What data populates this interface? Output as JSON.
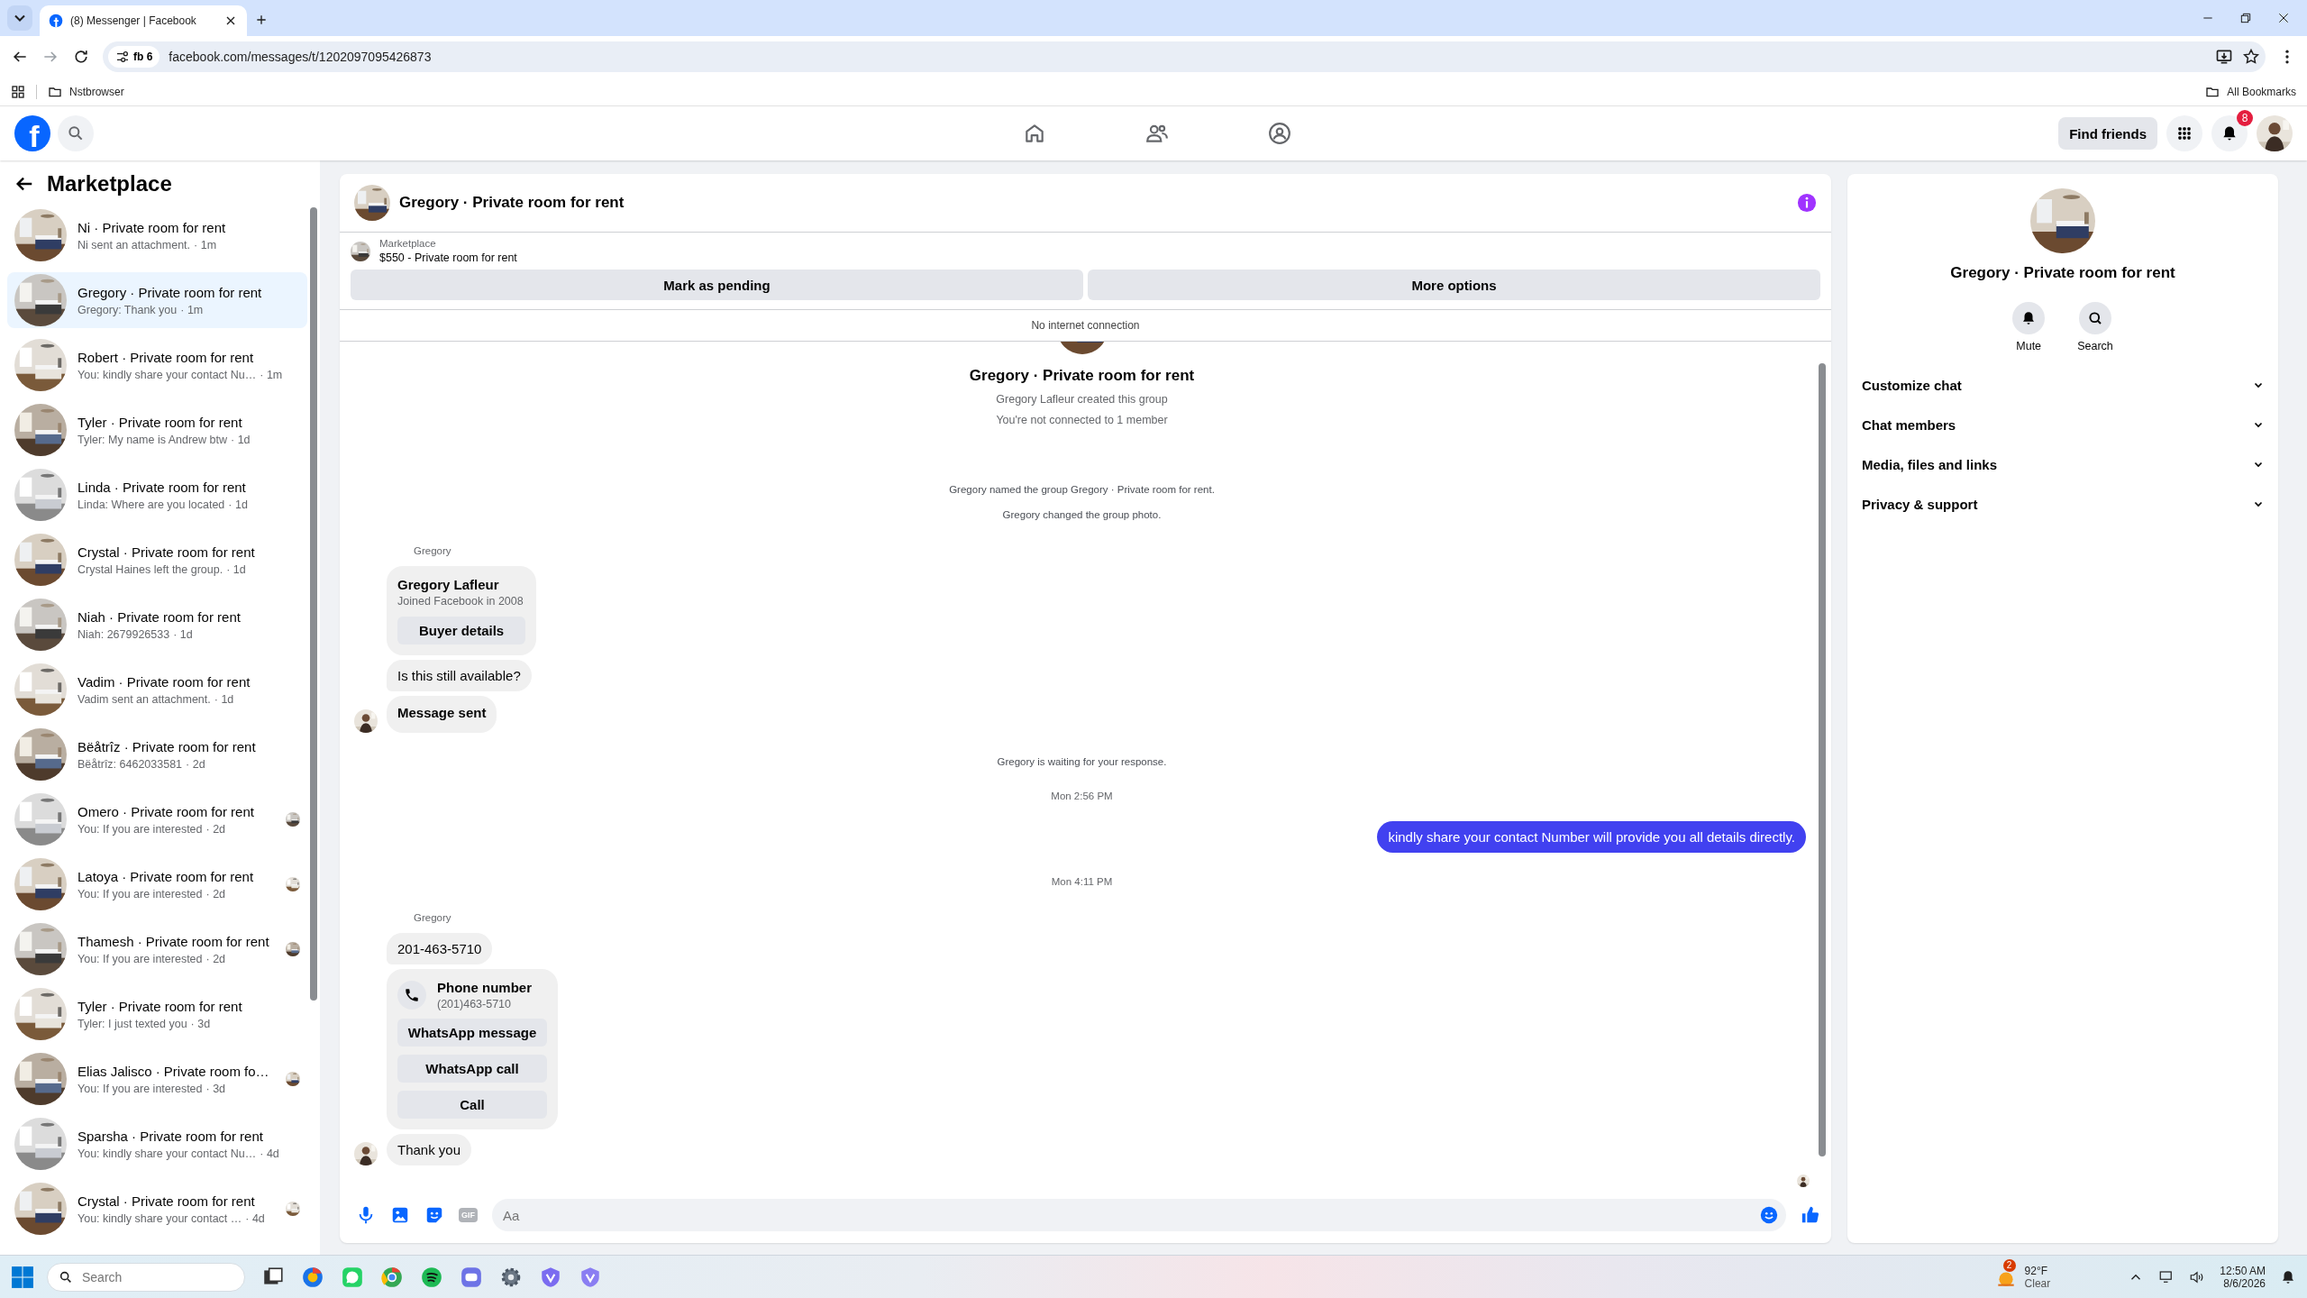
{
  "browser": {
    "tab_title": "(8) Messenger | Facebook",
    "chip": "fb 6",
    "url": "facebook.com/messages/t/1202097095426873",
    "bookmarks": [
      "Nstbrowser"
    ],
    "all_bookmarks": "All Bookmarks"
  },
  "header": {
    "logo": "f",
    "find_friends": "Find friends",
    "notification_count": "8"
  },
  "sidebar": {
    "title": "Marketplace",
    "conversations": [
      {
        "title": "Ni · Private room for rent",
        "preview": "Ni sent an attachment.",
        "time": "· 1m",
        "selected": false,
        "seen": false
      },
      {
        "title": "Gregory · Private room for rent",
        "preview": "Gregory: Thank you",
        "time": "· 1m",
        "selected": true,
        "seen": false
      },
      {
        "title": "Robert · Private room for rent",
        "preview": "You: kindly share your contact Nu…",
        "time": "· 1m",
        "selected": false,
        "seen": false
      },
      {
        "title": "Tyler · Private room for rent",
        "preview": "Tyler: My name is Andrew btw",
        "time": "· 1d",
        "selected": false,
        "seen": false
      },
      {
        "title": "Linda · Private room for rent",
        "preview": "Linda: Where are you located",
        "time": "· 1d",
        "selected": false,
        "seen": false
      },
      {
        "title": "Crystal · Private room for rent",
        "preview": "Crystal Haines left the group.",
        "time": "· 1d",
        "selected": false,
        "seen": false
      },
      {
        "title": "Niah · Private room for rent",
        "preview": "Niah: 2679926533",
        "time": "· 1d",
        "selected": false,
        "seen": false
      },
      {
        "title": "Vadim · Private room for rent",
        "preview": "Vadim sent an attachment.",
        "time": "· 1d",
        "selected": false,
        "seen": false
      },
      {
        "title": "Bëåtrîz · Private room for rent",
        "preview": "Bëåtrîz: 6462033581",
        "time": "· 2d",
        "selected": false,
        "seen": false
      },
      {
        "title": "Omero · Private room for rent",
        "preview": "You: If you are interested",
        "time": "· 2d",
        "selected": false,
        "seen": true
      },
      {
        "title": "Latoya · Private room for rent",
        "preview": "You: If you are interested",
        "time": "· 2d",
        "selected": false,
        "seen": true
      },
      {
        "title": "Thamesh · Private room for rent",
        "preview": "You: If you are interested",
        "time": "· 2d",
        "selected": false,
        "seen": true
      },
      {
        "title": "Tyler · Private room for rent",
        "preview": "Tyler: I just texted you",
        "time": "· 3d",
        "selected": false,
        "seen": false
      },
      {
        "title": "Elias Jalisco · Private room fo…",
        "preview": "You: If you are interested",
        "time": "· 3d",
        "selected": false,
        "seen": true
      },
      {
        "title": "Sparsha · Private room for rent",
        "preview": "You: kindly share your contact Nu…",
        "time": "· 4d",
        "selected": false,
        "seen": false
      },
      {
        "title": "Crystal · Private room for rent",
        "preview": "You: kindly share your contact …",
        "time": "· 4d",
        "selected": false,
        "seen": true
      }
    ]
  },
  "chat": {
    "title": "Gregory · Private room for rent",
    "listing": {
      "source": "Marketplace",
      "title": "$550 - Private room for rent"
    },
    "actions": [
      "Mark as pending",
      "More options"
    ],
    "banner": "No internet connection",
    "messages": [
      {
        "kind": "intro",
        "text": "Gregory · Private room for rent"
      },
      {
        "kind": "intro_line",
        "text": "Gregory Lafleur created this group"
      },
      {
        "kind": "intro_line",
        "text": "You're not connected to 1 member"
      },
      {
        "kind": "event",
        "text": "Gregory named the group Gregory · Private room for rent."
      },
      {
        "kind": "event",
        "text": "Gregory changed the group photo."
      },
      {
        "kind": "sender",
        "text": "Gregory"
      },
      {
        "kind": "profile_card",
        "name": "Gregory Lafleur",
        "subtitle": "Joined Facebook in 2008",
        "button": "Buyer details"
      },
      {
        "kind": "incoming",
        "text": "Is this still available?",
        "avatar": false,
        "bold": false
      },
      {
        "kind": "incoming",
        "text": "Message sent",
        "avatar": true,
        "bold": true
      },
      {
        "kind": "event",
        "text": "Gregory is waiting for your response."
      },
      {
        "kind": "timestamp",
        "text": "Mon 2:56 PM"
      },
      {
        "kind": "outgoing",
        "text": "kindly share your contact Number will provide you all details directly."
      },
      {
        "kind": "timestamp",
        "text": "Mon 4:11 PM"
      },
      {
        "kind": "sender",
        "text": "Gregory"
      },
      {
        "kind": "incoming",
        "text": "201-463-5710",
        "avatar": false,
        "bold": false
      },
      {
        "kind": "contact_card",
        "title": "Phone number",
        "subtitle": "(201)463-5710",
        "buttons": [
          "WhatsApp message",
          "WhatsApp call",
          "Call"
        ]
      },
      {
        "kind": "incoming",
        "text": "Thank you",
        "avatar": true,
        "bold": false
      },
      {
        "kind": "receipt"
      }
    ],
    "composer": {
      "placeholder": "Aa",
      "gif": "GIF"
    }
  },
  "details": {
    "title": "Gregory · Private room for rent",
    "actions": [
      {
        "kind": "mute",
        "label": "Mute"
      },
      {
        "kind": "search",
        "label": "Search"
      }
    ],
    "sections": [
      {
        "label": "Customize chat",
        "expanded": false
      },
      {
        "label": "Chat members",
        "expanded": false
      },
      {
        "label": "Media, files and links",
        "expanded": false
      },
      {
        "label": "Privacy & support",
        "expanded": false
      }
    ]
  },
  "taskbar": {
    "search_placeholder": "Search",
    "weather": {
      "badge": "2",
      "temp": "92°F",
      "condition": "Clear"
    },
    "time": "12:50 AM",
    "date": "8/6/2026"
  }
}
